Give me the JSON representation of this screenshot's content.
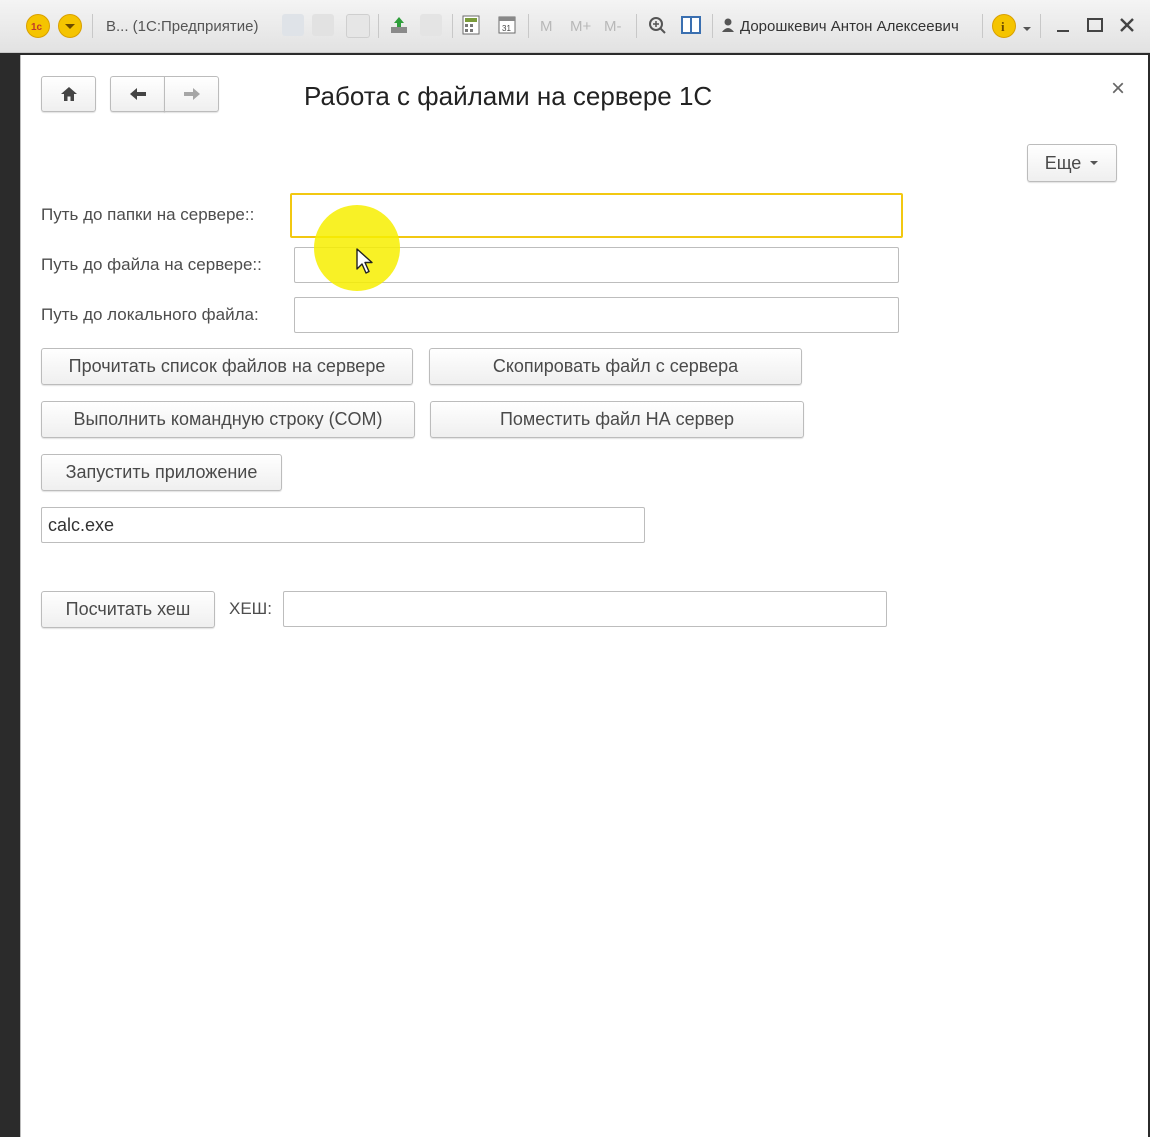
{
  "titlebar": {
    "app_title": "В... (1С:Предприятие)",
    "user_name": "Дорошкевич Антон Алексеевич",
    "m_label": "M",
    "m_plus_label": "M+",
    "m_minus_label": "M-"
  },
  "form": {
    "title": "Работа с файлами на сервере 1С",
    "more_label": "Еще",
    "close_glyph": "×"
  },
  "fields": {
    "server_folder_label": "Путь до папки на сервере::",
    "server_folder_value": "",
    "server_file_label": "Путь до файла на сервере::",
    "server_file_value": "",
    "local_file_label": "Путь до локального файла:",
    "local_file_value": "",
    "app_value": "calc.exe",
    "hash_label": "ХЕШ:",
    "hash_value": ""
  },
  "buttons": {
    "read_list": "Прочитать список файлов на сервере",
    "copy_from_server": "Скопировать файл с сервера",
    "run_cmd": "Выполнить командную строку  (COM)",
    "put_to_server": "Поместить файл НА сервер",
    "run_app": "Запустить приложение",
    "calc_hash": "Посчитать хеш"
  },
  "colors": {
    "focus_border": "#f2c811",
    "cursor_highlight": "#f7ee00"
  }
}
